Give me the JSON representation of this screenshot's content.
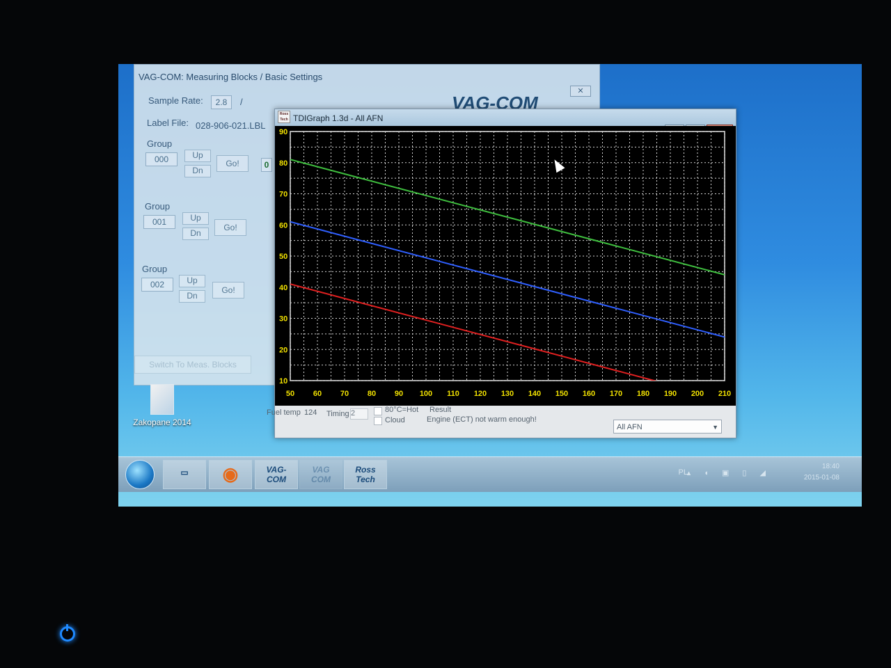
{
  "bg_window": {
    "title": "VAG-COM: Measuring Blocks / Basic Settings",
    "close_icon": "close-icon",
    "sample_rate_label": "Sample Rate:",
    "sample_rate_value": "2.8",
    "sample_rate_unit": "/",
    "label_file_label": "Label File:",
    "label_file_value": "028-906-021.LBL",
    "logo_text": "VAG-COM",
    "groups": [
      {
        "label": "Group",
        "value": "000",
        "up": "Up",
        "dn": "Dn",
        "go": "Go!"
      },
      {
        "label": "Group",
        "value": "001",
        "up": "Up",
        "dn": "Dn",
        "go": "Go!"
      },
      {
        "label": "Group",
        "value": "002",
        "up": "Up",
        "dn": "Dn",
        "go": "Go!"
      }
    ],
    "group0_side": "0",
    "switch_button": "Switch To Meas. Blocks"
  },
  "desktop_icon": {
    "label": "Zakopane 2014",
    "icon": "folder-image-icon"
  },
  "taskbar": {
    "start_icon": "windows-start-icon",
    "items": [
      {
        "name": "explorer",
        "icon": "folder-icon"
      },
      {
        "name": "firefox",
        "icon": "firefox-icon"
      },
      {
        "line1": "VAG-",
        "line2": "COM"
      },
      {
        "line1": "VAG",
        "line2": "COM"
      },
      {
        "line1": "Ross",
        "line2": "Tech"
      }
    ],
    "tray_lang": "PL",
    "tray_time": "18:40",
    "tray_date": "2015-01-08"
  },
  "tdi_window": {
    "logo_text": "Ross Tech",
    "title": "TDIGraph 1.3d - All AFN",
    "minimize_icon": "minimize-icon",
    "maximize_icon": "maximize-icon",
    "close_icon": "close-icon",
    "colors": {
      "plot_bg": "#000000",
      "grid": "#d8d8d8",
      "tick_labels": "#f2e200",
      "green": "#3fbf3f",
      "blue": "#2f5fff",
      "red": "#e02020"
    },
    "status": {
      "fuel_temp_label": "Fuel temp",
      "fuel_temp_value": "124",
      "timing_label": "Timing",
      "timing_value": "2",
      "check1_label": "80°C=Hot",
      "check2_label": "Cloud",
      "result_label": "Result",
      "result_value": "Engine (ECT) not warm enough!",
      "dropdown_value": "All AFN",
      "dropdown_icon": "chevron-down-icon"
    }
  },
  "chart_data": {
    "type": "line",
    "title": "",
    "xlabel": "",
    "ylabel": "",
    "xlim": [
      50,
      210
    ],
    "ylim": [
      10,
      90
    ],
    "xticks": [
      50,
      60,
      70,
      80,
      90,
      100,
      110,
      120,
      130,
      140,
      150,
      160,
      170,
      180,
      190,
      200,
      210
    ],
    "yticks": [
      10,
      20,
      30,
      40,
      50,
      60,
      70,
      80,
      90
    ],
    "grid": true,
    "series": [
      {
        "color": "#3fbf3f",
        "x": [
          50,
          210
        ],
        "y": [
          81,
          44
        ]
      },
      {
        "color": "#2f5fff",
        "x": [
          50,
          210
        ],
        "y": [
          61,
          24
        ]
      },
      {
        "color": "#e02020",
        "x": [
          50,
          210
        ],
        "y": [
          41,
          4
        ]
      }
    ]
  }
}
